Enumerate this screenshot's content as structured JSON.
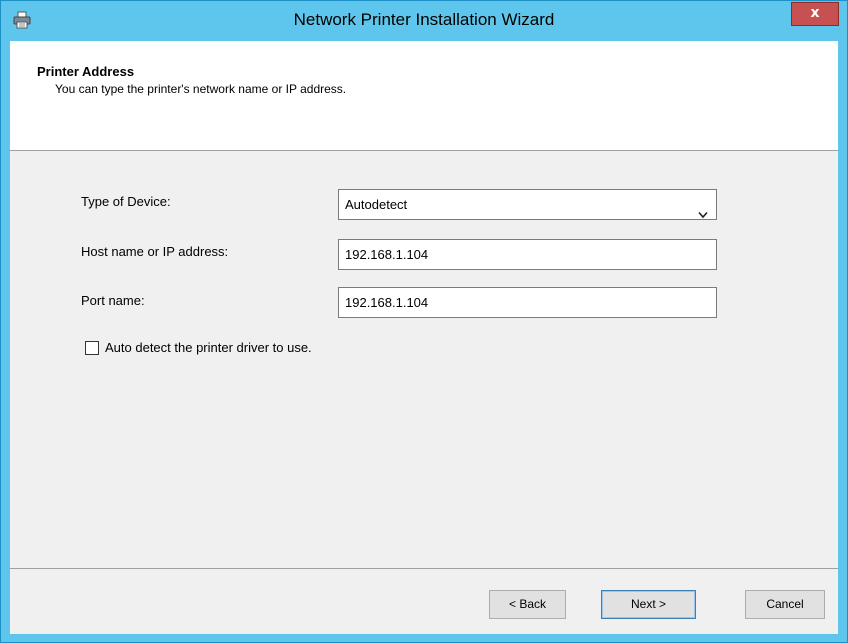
{
  "window": {
    "title": "Network Printer Installation Wizard",
    "icon": "printer-icon",
    "close_label": "x",
    "accent_color": "#5ec6ec"
  },
  "header": {
    "title": "Printer Address",
    "subtitle": "You can type the printer's network name or IP address."
  },
  "form": {
    "device_type_label": "Type of Device:",
    "device_type_value": "Autodetect",
    "host_label": "Host name or IP address:",
    "host_value": "192.168.1.104",
    "port_label": "Port name:",
    "port_value": "192.168.1.104",
    "auto_detect_label": "Auto detect the printer driver to use.",
    "auto_detect_checked": false
  },
  "buttons": {
    "back": "< Back",
    "next": "Next >",
    "cancel": "Cancel"
  }
}
